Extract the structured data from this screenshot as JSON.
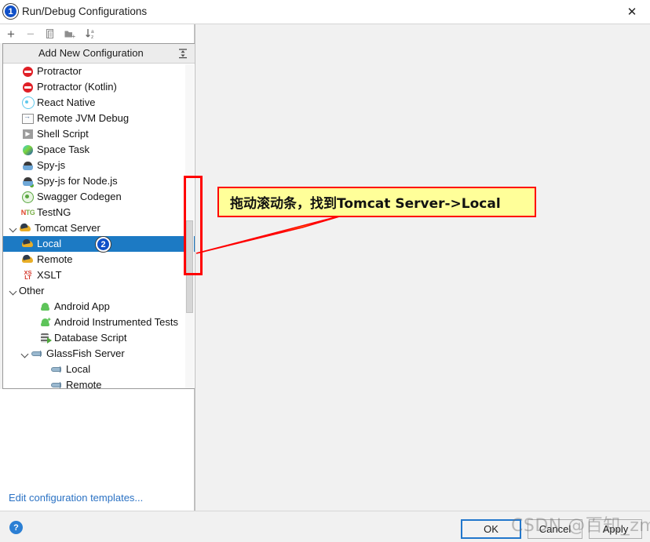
{
  "dialog": {
    "title": "Run/Debug Configurations",
    "close_label": "✕"
  },
  "badges": {
    "one": "1",
    "two": "2"
  },
  "toolbar": {
    "add_label": "+",
    "remove_label": "−",
    "copy_name": "copy-configuration",
    "folder_name": "new-folder",
    "sort_name": "sort-alphabetically"
  },
  "list": {
    "header": "Add New Configuration",
    "collapse_tooltip": "Collapse All",
    "items": [
      {
        "label": "Protractor",
        "icon": "protractor-icon",
        "indent": 1,
        "expandable": false,
        "selected": false
      },
      {
        "label": "Protractor (Kotlin)",
        "icon": "protractor-icon",
        "indent": 1,
        "expandable": false,
        "selected": false
      },
      {
        "label": "React Native",
        "icon": "react-icon",
        "indent": 1,
        "expandable": false,
        "selected": false
      },
      {
        "label": "Remote JVM Debug",
        "icon": "remote-jvm-icon",
        "indent": 1,
        "expandable": false,
        "selected": false
      },
      {
        "label": "Shell Script",
        "icon": "shell-script-icon",
        "indent": 1,
        "expandable": false,
        "selected": false
      },
      {
        "label": "Space Task",
        "icon": "space-icon",
        "indent": 1,
        "expandable": false,
        "selected": false
      },
      {
        "label": "Spy-js",
        "icon": "spy-js-icon",
        "indent": 1,
        "expandable": false,
        "selected": false
      },
      {
        "label": "Spy-js for Node.js",
        "icon": "spy-js-node-icon",
        "indent": 1,
        "expandable": false,
        "selected": false
      },
      {
        "label": "Swagger Codegen",
        "icon": "swagger-icon",
        "indent": 1,
        "expandable": false,
        "selected": false
      },
      {
        "label": "TestNG",
        "icon": "testng-icon",
        "indent": 1,
        "expandable": false,
        "selected": false
      },
      {
        "label": "Tomcat Server",
        "icon": "tomcat-icon",
        "indent": 0,
        "expandable": true,
        "selected": false
      },
      {
        "label": "Local",
        "icon": "tomcat-icon",
        "indent": 2,
        "expandable": false,
        "selected": true
      },
      {
        "label": "Remote",
        "icon": "tomcat-icon",
        "indent": 2,
        "expandable": false,
        "selected": false
      },
      {
        "label": "XSLT",
        "icon": "xslt-icon",
        "indent": 1,
        "expandable": false,
        "selected": false
      },
      {
        "label": "Other",
        "icon": "none",
        "indent": 0,
        "expandable": true,
        "selected": false
      },
      {
        "label": "Android App",
        "icon": "android-icon",
        "indent": 3,
        "expandable": false,
        "selected": false
      },
      {
        "label": "Android Instrumented Tests",
        "icon": "android-test-icon",
        "indent": 3,
        "expandable": false,
        "selected": false
      },
      {
        "label": "Database Script",
        "icon": "database-icon",
        "indent": 3,
        "expandable": false,
        "selected": false
      },
      {
        "label": "GlassFish Server",
        "icon": "glassfish-icon",
        "indent": 2,
        "expandable": true,
        "selected": false
      },
      {
        "label": "Local",
        "icon": "glassfish-icon",
        "indent": 4,
        "expandable": false,
        "selected": false
      },
      {
        "label": "Remote",
        "icon": "glassfish-icon",
        "indent": 4,
        "expandable": false,
        "selected": false
      }
    ]
  },
  "footer": {
    "edit_templates": "Edit configuration templates...",
    "help_label": "?",
    "ok_label": "OK",
    "cancel_label": "Cancel",
    "apply_label": "Apply"
  },
  "annotation": {
    "callout_text": "拖动滚动条，找到Tomcat Server->Local",
    "highlight_color": "#ff0000",
    "callout_bg": "#ffff99"
  },
  "watermark": {
    "text": "CSDN @百知_zmj"
  }
}
